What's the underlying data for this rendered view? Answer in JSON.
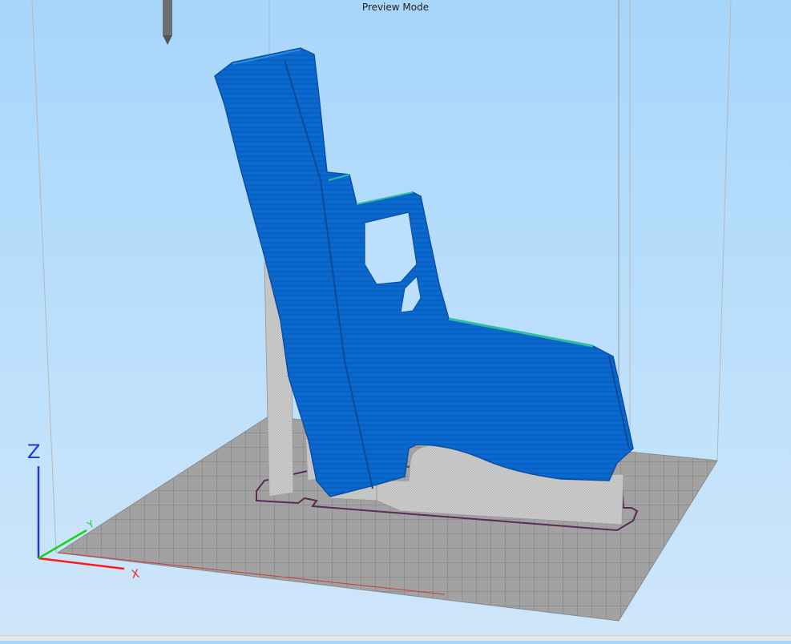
{
  "viewport": {
    "mode_label": "Preview Mode",
    "background_top": "#a7d6fb",
    "background_bottom": "#cfe6fa"
  },
  "colors": {
    "model": "#0a6ad0",
    "model_dark": "#0b54ad",
    "model_highlight": "#2fbfa0",
    "support": "#c9c9c9",
    "bed": "#9c9c9c",
    "bed_grid": "#7e7e7e",
    "skirt": "#5a2a55",
    "axis_x": "#ff1a1a",
    "axis_y": "#1cd11c",
    "axis_z": "#1d3bd6",
    "nozzle": "#6a6a6a"
  },
  "axes": {
    "x_label": "X",
    "y_label": "Y",
    "z_label": "Z"
  }
}
